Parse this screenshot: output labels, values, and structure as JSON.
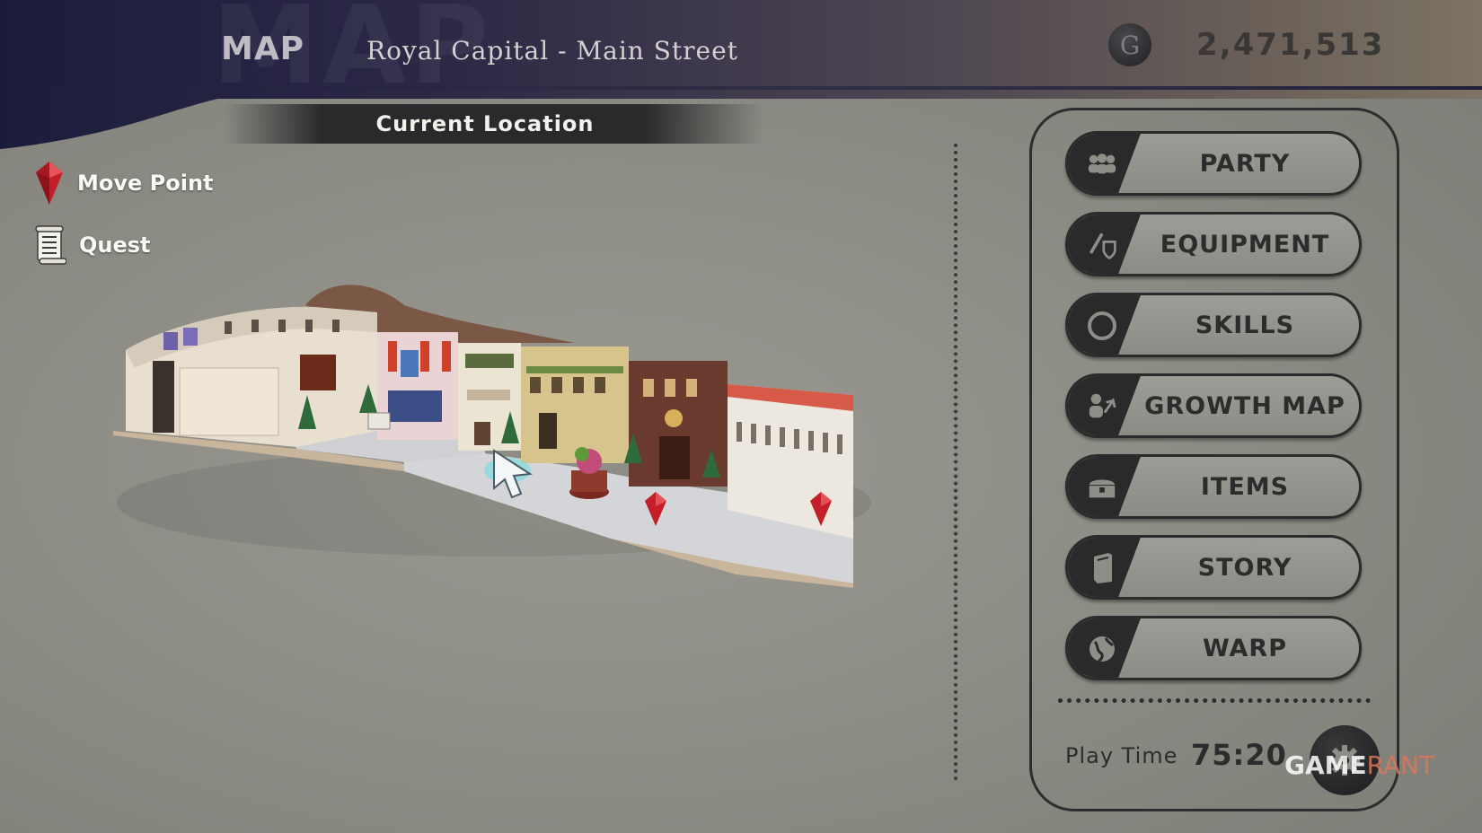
{
  "header": {
    "title": "MAP",
    "location": "Royal Capital - Main Street",
    "currency_icon": "G",
    "gold": "2,471,513"
  },
  "current_location": {
    "label": "Current Location"
  },
  "legend": [
    {
      "label": "Move Point",
      "icon": "red-crystal-icon"
    },
    {
      "label": "Quest",
      "icon": "scroll-icon"
    }
  ],
  "menu": [
    {
      "label": "PARTY",
      "icon": "party-icon"
    },
    {
      "label": "EQUIPMENT",
      "icon": "sword-shield-icon"
    },
    {
      "label": "SKILLS",
      "icon": "circle-icon"
    },
    {
      "label": "GROWTH MAP",
      "icon": "growth-icon"
    },
    {
      "label": "ITEMS",
      "icon": "chest-icon"
    },
    {
      "label": "STORY",
      "icon": "book-icon"
    },
    {
      "label": "WARP",
      "icon": "globe-icon"
    }
  ],
  "footer": {
    "playtime_label": "Play Time",
    "playtime_value": "75:20"
  },
  "watermark": {
    "part1": "GAME",
    "part2": "RANT"
  },
  "colors": {
    "background": "#8c8b84",
    "header_dark": "#1b1c3c",
    "button_dark": "#2a2a2b",
    "move_point_red": "#c8202a"
  }
}
